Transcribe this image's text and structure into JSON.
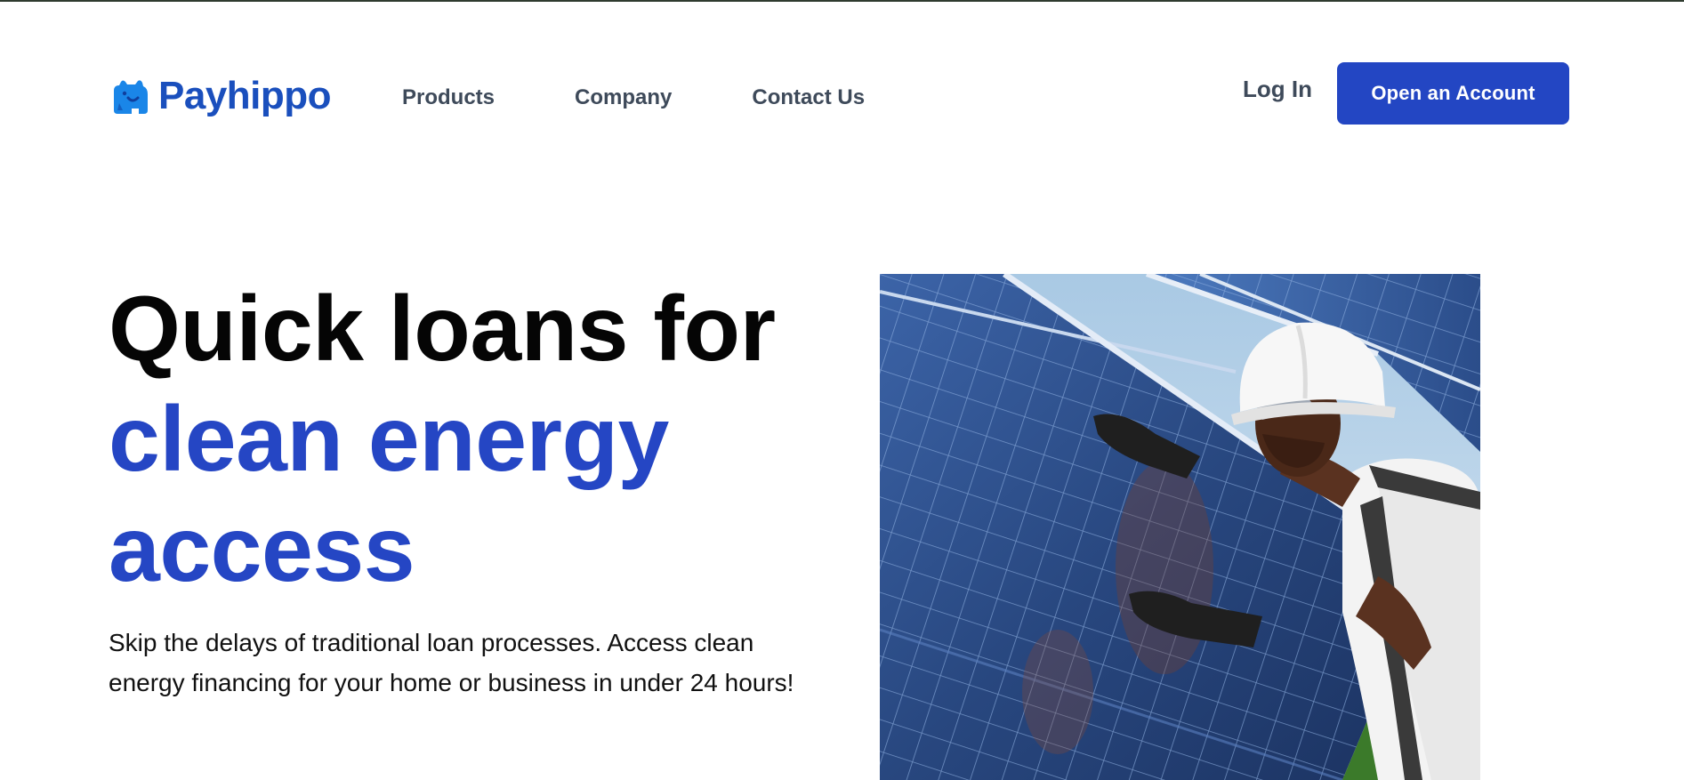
{
  "brand": {
    "name": "Payhippo",
    "color": "#1a4fbd"
  },
  "nav": {
    "items": [
      {
        "label": "Products"
      },
      {
        "label": "Company"
      },
      {
        "label": "Contact Us"
      }
    ]
  },
  "header_actions": {
    "login_label": "Log In",
    "cta_label": "Open an Account",
    "cta_color": "#2346c3"
  },
  "hero": {
    "title_line1": "Quick loans for",
    "title_line2": "clean energy",
    "title_line3": "access",
    "accent_color": "#2546c4",
    "subtitle": "Skip the delays of traditional loan processes. Access clean energy financing for your home or business in under 24 hours!",
    "image_icon": "solar-worker-photo"
  }
}
